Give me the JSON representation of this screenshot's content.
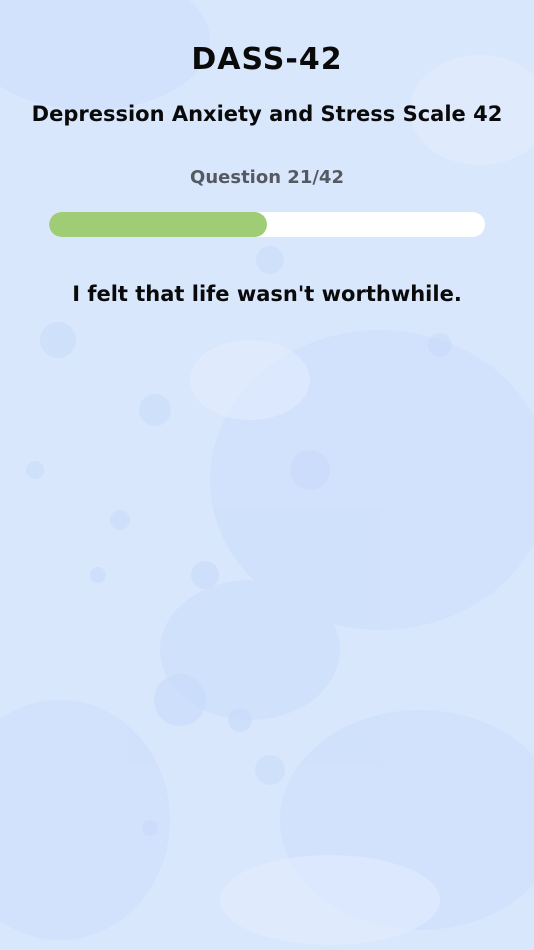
{
  "header": {
    "title": "DASS-42",
    "subtitle": "Depression Anxiety and Stress Scale 42"
  },
  "progress": {
    "label": "Question 21/42",
    "current": 21,
    "total": 42,
    "fraction": 0.5,
    "fill_color": "#9ecd76",
    "track_color": "#ffffff"
  },
  "question": {
    "text": "I felt that life wasn't worthwhile."
  },
  "theme": {
    "background": "#d8e6fd"
  }
}
